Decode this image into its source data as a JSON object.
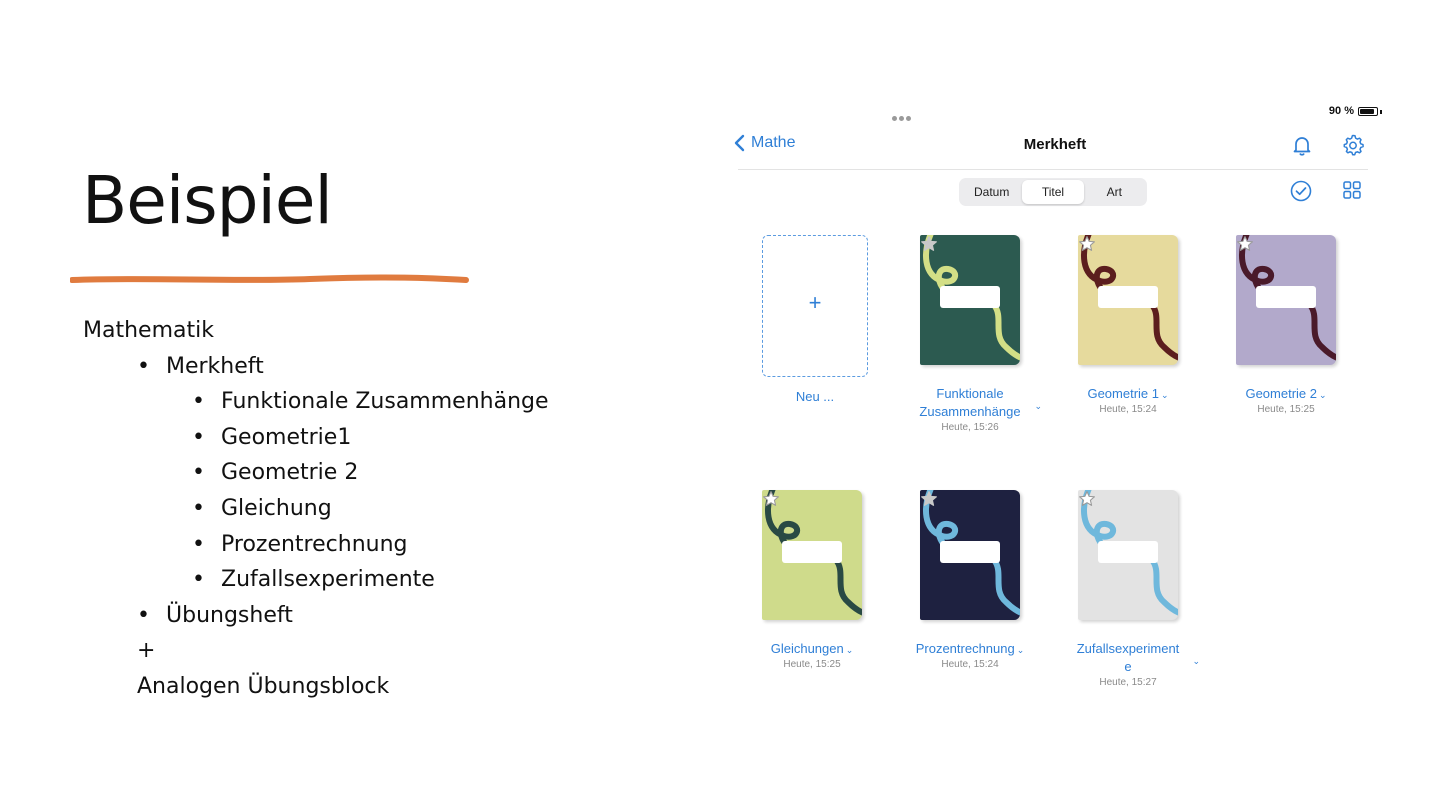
{
  "slide": {
    "title": "Beispiel",
    "accent_color": "#e07b3f",
    "outline": [
      {
        "text": "Mathematik",
        "level": 0,
        "bullet": ""
      },
      {
        "text": "Merkheft",
        "level": 1,
        "bullet": "•"
      },
      {
        "text": "Funktionale Zusammenhänge",
        "level": 2,
        "bullet": "•"
      },
      {
        "text": "Geometrie1",
        "level": 2,
        "bullet": "•"
      },
      {
        "text": "Geometrie 2",
        "level": 2,
        "bullet": "•"
      },
      {
        "text": "Gleichung",
        "level": 2,
        "bullet": "•"
      },
      {
        "text": "Prozentrechnung",
        "level": 2,
        "bullet": "•"
      },
      {
        "text": "Zufallsexperimente",
        "level": 2,
        "bullet": "•"
      },
      {
        "text": "Übungsheft",
        "level": 1,
        "bullet": "•"
      },
      {
        "text": "+",
        "level": 1,
        "bullet": ""
      },
      {
        "text": "Analogen Übungsblock",
        "level": 1,
        "bullet": ""
      }
    ]
  },
  "app": {
    "battery_text": "90 %",
    "battery_level": 0.9,
    "back_label": "Mathe",
    "title": "Merkheft",
    "accent": "#2f7fd6",
    "sort_tabs": [
      {
        "label": "Datum",
        "active": false
      },
      {
        "label": "Titel",
        "active": true
      },
      {
        "label": "Art",
        "active": false
      }
    ],
    "new_button": {
      "plus": "+",
      "label": "Neu ..."
    },
    "notebooks": [
      {
        "title": "Funktionale Zusammenhänge",
        "title_lines": [
          "Funktionale",
          "Zusammenhänge"
        ],
        "date": "Heute, 15:26",
        "cover": "#2c5a50",
        "ribbon": "#d3df86",
        "starred": false
      },
      {
        "title": "Geometrie 1",
        "title_lines": [
          "Geometrie 1"
        ],
        "date": "Heute, 15:24",
        "cover": "#e6da9d",
        "ribbon": "#5c1e1e",
        "starred": false
      },
      {
        "title": "Geometrie 2",
        "title_lines": [
          "Geometrie 2"
        ],
        "date": "Heute, 15:25",
        "cover": "#b2a9cb",
        "ribbon": "#4a1a2a",
        "starred": false
      },
      {
        "title": "Gleichungen",
        "title_lines": [
          "Gleichungen"
        ],
        "date": "Heute, 15:25",
        "cover": "#cfdb8b",
        "ribbon": "#2a4a44",
        "starred": false
      },
      {
        "title": "Prozentrechnung",
        "title_lines": [
          "Prozentrechnung"
        ],
        "date": "Heute, 15:24",
        "cover": "#1e2140",
        "ribbon": "#6fb8dc",
        "starred": false
      },
      {
        "title": "Zufallsexperimente",
        "title_lines": [
          "Zufallsexperiment",
          "e"
        ],
        "date": "Heute, 15:27",
        "cover": "#e3e3e3",
        "ribbon": "#6fb8dc",
        "starred": false
      }
    ]
  }
}
